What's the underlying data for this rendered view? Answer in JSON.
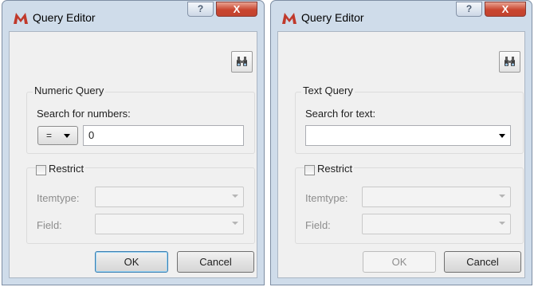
{
  "colors": {
    "close_red": "#c9452f",
    "frame_blue": "#cfdcea",
    "default_button_border": "#3c7fb1"
  },
  "dialogs": [
    {
      "title": "Query Editor",
      "app_icon": "m-logo-icon",
      "help_label": "?",
      "close_label": "X",
      "tool_icon": "binoculars-icon",
      "query_group_label": "Numeric Query",
      "search_label": "Search for numbers:",
      "operator": "=",
      "search_value": "0",
      "restrict_label": "Restrict",
      "restrict_checked": false,
      "itemtype_label": "Itemtype:",
      "field_label": "Field:",
      "ok_label": "OK",
      "ok_enabled": true,
      "cancel_label": "Cancel"
    },
    {
      "title": "Query Editor",
      "app_icon": "m-logo-icon",
      "help_label": "?",
      "close_label": "X",
      "tool_icon": "binoculars-icon",
      "query_group_label": "Text Query",
      "search_label": "Search for text:",
      "search_value": "",
      "restrict_label": "Restrict",
      "restrict_checked": false,
      "itemtype_label": "Itemtype:",
      "field_label": "Field:",
      "ok_label": "OK",
      "ok_enabled": false,
      "cancel_label": "Cancel"
    }
  ]
}
